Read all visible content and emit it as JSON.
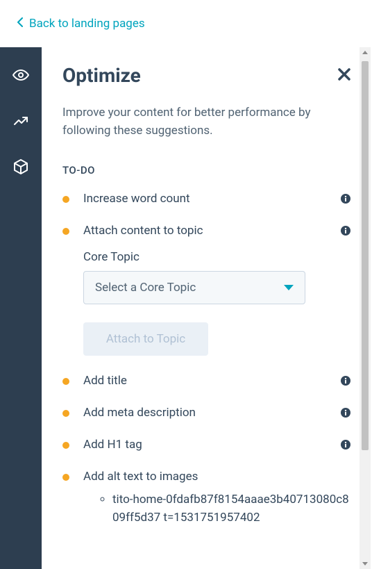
{
  "back_link": "Back to landing pages",
  "panel": {
    "title": "Optimize",
    "subtitle": "Improve your content for better performance by following these suggestions.",
    "section_label": "TO-DO",
    "core_topic_label": "Core Topic",
    "select_placeholder": "Select a Core Topic",
    "attach_button": "Attach to Topic"
  },
  "todos": [
    {
      "label": "Increase word count",
      "has_info": true
    },
    {
      "label": "Attach content to topic",
      "has_info": true
    },
    {
      "label": "Add title",
      "has_info": true
    },
    {
      "label": "Add meta description",
      "has_info": true
    },
    {
      "label": "Add H1 tag",
      "has_info": true
    },
    {
      "label": "Add alt text to images",
      "has_info": false
    }
  ],
  "alt_text_items": [
    "tito-home-0fdafb87f8154aaae3b40713080c809ff5d37  t=1531751957402"
  ]
}
